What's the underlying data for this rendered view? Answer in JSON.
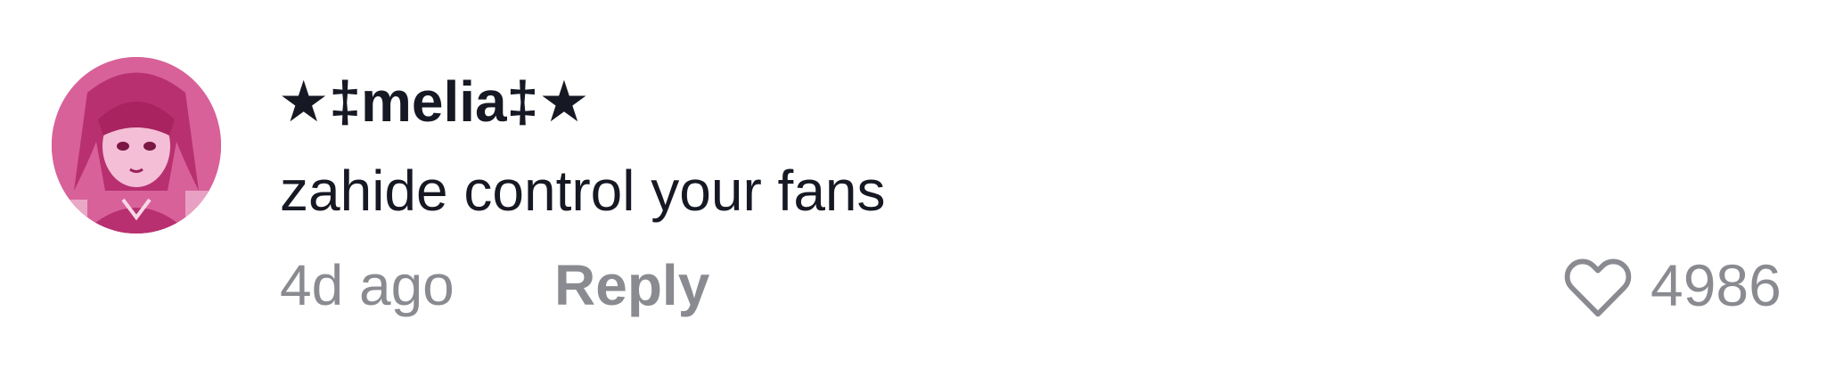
{
  "comment": {
    "username": "★‡melia‡★",
    "text": "zahide control your fans",
    "time": "4d ago",
    "reply_label": "Reply",
    "like_count": "4986",
    "icons": {
      "like": "heart-outline-icon",
      "avatar": "user-avatar"
    },
    "colors": {
      "primary_text": "#161823",
      "secondary_text": "#8a8b91",
      "avatar_tint": "#d4558f"
    }
  }
}
